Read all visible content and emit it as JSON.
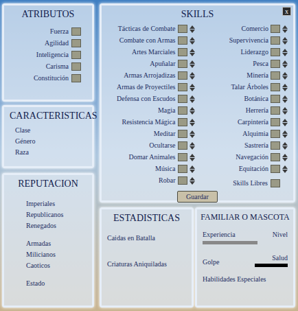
{
  "attributes": {
    "title": "ATRIBUTOS",
    "items": [
      "Fuerza",
      "Agilidad",
      "Inteligencia",
      "Carisma",
      "Constitución"
    ]
  },
  "characteristics": {
    "title": "CARACTERISTICAS",
    "items": [
      "Clase",
      "Género",
      "Raza"
    ]
  },
  "reputation": {
    "title": "REPUTACION",
    "groups": [
      [
        "Imperiales",
        "Republicanos",
        "Renegados"
      ],
      [
        "Armadas",
        "Milicianos",
        "Caoticos"
      ],
      [
        "Estado"
      ]
    ]
  },
  "skills": {
    "title": "SKILLS",
    "close": "x",
    "left": [
      "Tácticas de Combate",
      "Combate con Armas",
      "Artes Marciales",
      "Apuñalar",
      "Armas Arrojadizas",
      "Armas de Proyectiles",
      "Defensa con Escudos",
      "Magia",
      "Resistencia Mágica",
      "Meditar",
      "Ocultarse",
      "Domar Animales",
      "Música",
      "Robar"
    ],
    "right": [
      "Comercio",
      "Supervivencia",
      "Liderazgo",
      "Pesca",
      "Minería",
      "Talar Árboles",
      "Botánica",
      "Herrería",
      "Carpintería",
      "Alquimia",
      "Sastrería",
      "Navegación",
      "Equitación"
    ],
    "free": "Skills Libres",
    "button": "Guardar"
  },
  "statistics": {
    "title": "ESTADISTICAS",
    "items": [
      "Caidas en Batalla",
      "Criaturas Aniquiladas"
    ]
  },
  "pet": {
    "title": "FAMILIAR O MASCOTA",
    "experience": "Experiencia",
    "experience_level": 0,
    "level": "Nivel",
    "hit": "Golpe",
    "health": "Salud",
    "health_level": 1,
    "special": "Habilidades Especiales"
  }
}
